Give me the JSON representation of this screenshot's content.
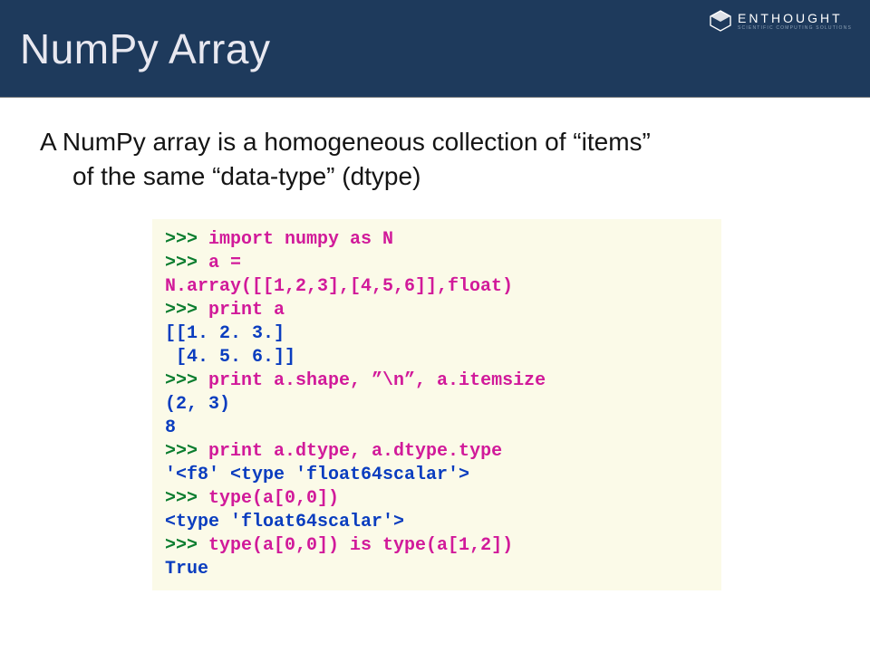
{
  "header": {
    "title": "NumPy Array",
    "brand": "ENTHOUGHT",
    "brand_sub": "SCIENTIFIC COMPUTING SOLUTIONS"
  },
  "body": {
    "intro_line1": "A NumPy array is a homogeneous collection of “items”",
    "intro_line2": "of the same “data-type” (dtype)"
  },
  "code": {
    "lines": [
      {
        "parts": [
          {
            "cls": "prompt",
            "t": ">>> "
          },
          {
            "cls": "input",
            "t": "import numpy as N"
          }
        ]
      },
      {
        "parts": [
          {
            "cls": "prompt",
            "t": ">>> "
          },
          {
            "cls": "input",
            "t": "a ="
          }
        ]
      },
      {
        "parts": [
          {
            "cls": "input",
            "t": "N.array([[1,2,3],[4,5,6]],float)"
          }
        ]
      },
      {
        "parts": [
          {
            "cls": "prompt",
            "t": ">>> "
          },
          {
            "cls": "input",
            "t": "print a"
          }
        ]
      },
      {
        "parts": [
          {
            "cls": "output",
            "t": "[[1. 2. 3.]"
          }
        ]
      },
      {
        "parts": [
          {
            "cls": "output",
            "t": " [4. 5. 6.]]"
          }
        ]
      },
      {
        "parts": [
          {
            "cls": "prompt",
            "t": ">>> "
          },
          {
            "cls": "input",
            "t": "print a.shape, ”\\n”, a.itemsize"
          }
        ]
      },
      {
        "parts": [
          {
            "cls": "output",
            "t": "(2, 3)"
          }
        ]
      },
      {
        "parts": [
          {
            "cls": "output",
            "t": "8"
          }
        ]
      },
      {
        "parts": [
          {
            "cls": "prompt",
            "t": ">>> "
          },
          {
            "cls": "input",
            "t": "print a.dtype, a.dtype.type"
          }
        ]
      },
      {
        "parts": [
          {
            "cls": "output",
            "t": "'<f8' <type 'float64scalar'>"
          }
        ]
      },
      {
        "parts": [
          {
            "cls": "prompt",
            "t": ">>> "
          },
          {
            "cls": "input",
            "t": "type(a[0,0])"
          }
        ]
      },
      {
        "parts": [
          {
            "cls": "output",
            "t": "<type 'float64scalar'>"
          }
        ]
      },
      {
        "parts": [
          {
            "cls": "prompt",
            "t": ">>> "
          },
          {
            "cls": "input",
            "t": "type(a[0,0]) is type(a[1,2])"
          }
        ]
      },
      {
        "parts": [
          {
            "cls": "output",
            "t": "True"
          }
        ]
      }
    ]
  }
}
